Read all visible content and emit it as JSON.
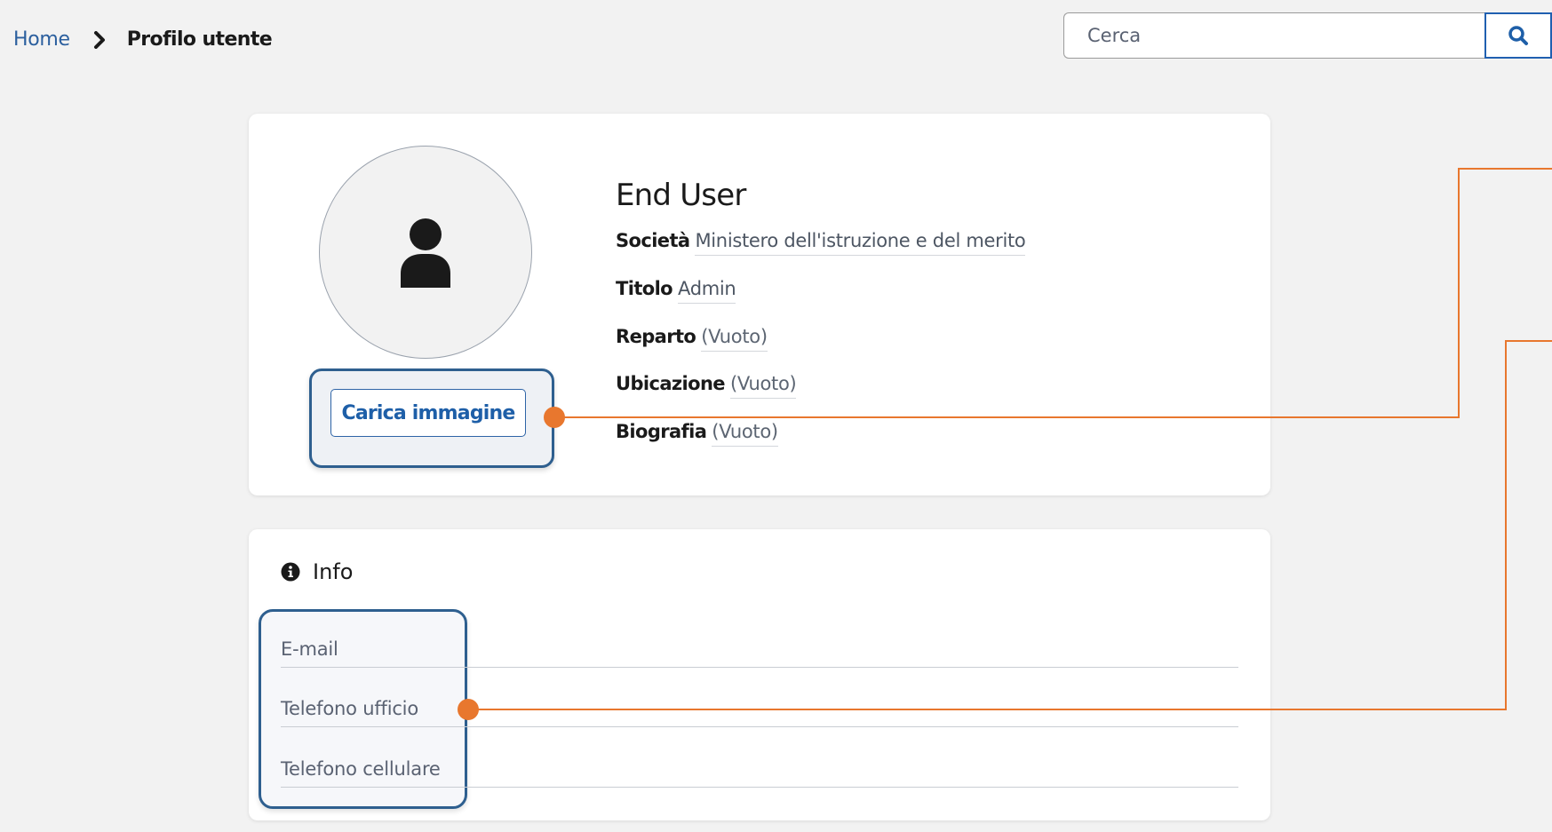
{
  "breadcrumb": {
    "home": "Home",
    "current": "Profilo utente"
  },
  "search": {
    "placeholder": "Cerca"
  },
  "profile": {
    "name": "End User",
    "upload_label": "Carica immagine",
    "fields": [
      {
        "label": "Società",
        "value": "Ministero dell'istruzione e del merito"
      },
      {
        "label": "Titolo",
        "value": "Admin"
      },
      {
        "label": "Reparto",
        "value": "(Vuoto)"
      },
      {
        "label": "Ubicazione",
        "value": "(Vuoto)"
      },
      {
        "label": "Biografia",
        "value": "(Vuoto)"
      }
    ]
  },
  "info": {
    "title": "Info",
    "fields": [
      "E-mail",
      "Telefono ufficio",
      "Telefono cellulare"
    ]
  },
  "colors": {
    "link": "#2b5f9e",
    "accent": "#1e5fa8",
    "highlight_border": "#2e5f8f",
    "callout": "#e8772e",
    "background": "#f2f2f2"
  },
  "icons": [
    "chevron-right-icon",
    "search-icon",
    "user-icon",
    "info-icon"
  ]
}
